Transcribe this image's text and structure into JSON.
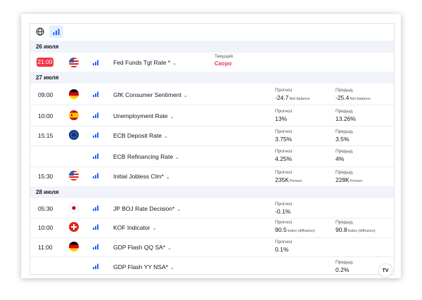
{
  "toolbar": {
    "items": [
      {
        "icon": "globe-icon",
        "active": false
      },
      {
        "icon": "importance-bars-icon",
        "active": true
      }
    ]
  },
  "colors": {
    "accent_blue": "#2962ff",
    "alert_red": "#f23645",
    "date_row_bg": "#f0f3fa"
  },
  "days": [
    {
      "date": "26 июля",
      "events": [
        {
          "time": "21:00",
          "time_alert": true,
          "flag": "us-flag-icon",
          "name": "Fed Funds Tgt Rate *",
          "current_label": "Текущий",
          "current_value": "Скоро"
        }
      ]
    },
    {
      "date": "27 июля",
      "events": [
        {
          "time": "09:00",
          "flag": "de-flag-icon",
          "name": "GfK Consumer Sentiment",
          "forecast_label": "Прогноз",
          "forecast_value": "-24.7",
          "forecast_unit": "Net balance",
          "previous_label": "Предыд.",
          "previous_value": "-25.4",
          "previous_unit": "Net balance"
        },
        {
          "time": "10:00",
          "flag": "es-flag-icon",
          "name": "Unemployment Rate",
          "forecast_label": "Прогноз",
          "forecast_value": "13%",
          "previous_label": "Предыд.",
          "previous_value": "13.26%"
        },
        {
          "time": "15:15",
          "flag": "eu-flag-icon",
          "name": "ECB Deposit Rate",
          "forecast_label": "Прогноз",
          "forecast_value": "3.75%",
          "previous_label": "Предыд.",
          "previous_value": "3.5%"
        },
        {
          "time": "",
          "flag": "",
          "name": "ECB Refinancing Rate",
          "forecast_label": "Прогноз",
          "forecast_value": "4.25%",
          "previous_label": "Предыд.",
          "previous_value": "4%"
        },
        {
          "time": "15:30",
          "flag": "us-flag-icon",
          "name": "Initial Jobless Clm*",
          "forecast_label": "Прогноз",
          "forecast_value": "235K",
          "forecast_unit": "Person",
          "previous_label": "Предыд.",
          "previous_value": "228K",
          "previous_unit": "Person"
        }
      ]
    },
    {
      "date": "28 июля",
      "events": [
        {
          "time": "05:30",
          "flag": "jp-flag-icon",
          "name": "JP BOJ Rate Decision*",
          "forecast_label": "Прогноз",
          "forecast_value": "-0.1%"
        },
        {
          "time": "10:00",
          "flag": "ch-flag-icon",
          "name": "KOF Indicator",
          "forecast_label": "Прогноз",
          "forecast_value": "90.5",
          "forecast_unit": "Index (diffusion)",
          "previous_label": "Предыд.",
          "previous_value": "90.8",
          "previous_unit": "Index (diffusion)"
        },
        {
          "time": "11:00",
          "flag": "de-flag-icon",
          "name": "GDP Flash QQ SA*",
          "forecast_label": "Прогноз",
          "forecast_value": "0.1%"
        },
        {
          "time": "",
          "flag": "",
          "name": "GDP Flash YY NSA*",
          "previous_label": "Предыд.",
          "previous_value": "0.2%"
        }
      ]
    }
  ],
  "brand": {
    "logo_text": "TV"
  }
}
